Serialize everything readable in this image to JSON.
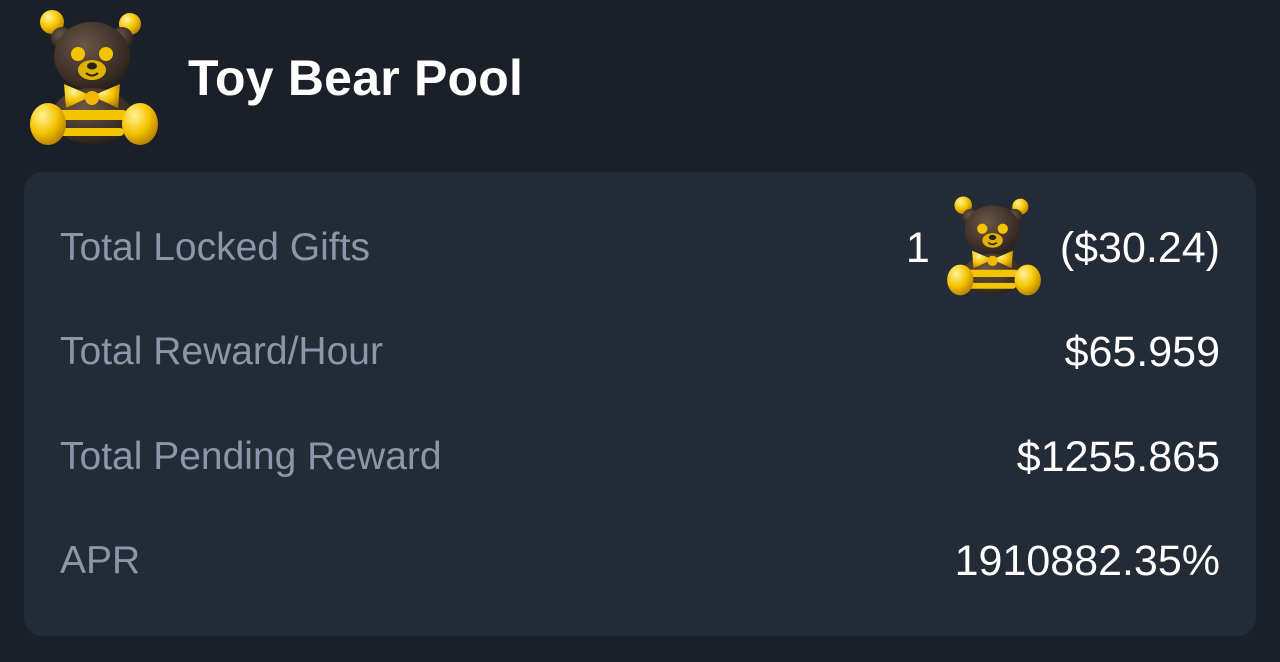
{
  "header": {
    "title": "Toy Bear Pool",
    "icon": "toy-bear-icon"
  },
  "stats": {
    "locked_gifts": {
      "label": "Total Locked Gifts",
      "count": "1",
      "icon": "toy-bear-icon",
      "usd": "($30.24)"
    },
    "reward_per_hour": {
      "label": "Total Reward/Hour",
      "value": "$65.959"
    },
    "pending_reward": {
      "label": "Total Pending Reward",
      "value": "$1255.865"
    },
    "apr": {
      "label": "APR",
      "value": "1910882.35%"
    }
  },
  "colors": {
    "background": "#1a1f28",
    "card": "#232b37",
    "label": "#8b96a8",
    "value": "#ffffff",
    "accent_gold": "#f5c400"
  }
}
